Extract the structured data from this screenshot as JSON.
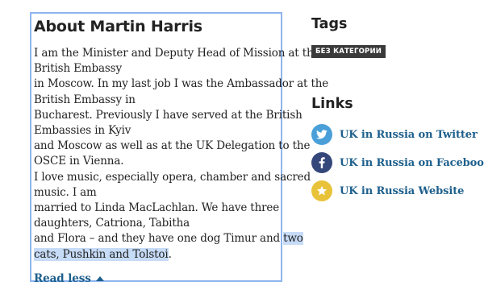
{
  "about": {
    "title": "About Martin Harris",
    "bio_lines": [
      "I am the Minister and Deputy Head of Mission at the",
      "British Embassy",
      "in Moscow. In my last job I was the Ambassador at the",
      "British Embassy in",
      "Bucharest. Previously I have served at the British",
      "Embassies in Kyiv",
      "and Moscow as well as at the UK Delegation to the",
      "OSCE in Vienna.",
      "I love music, especially opera, chamber and sacred",
      "music. I am",
      "married to Linda MacLachlan. We have three",
      "daughters, Catriona, Tabitha"
    ],
    "line13_plain": "and Flora – and they have one dog Timur and ",
    "line13_selected": "two",
    "line14_selected": "cats, Pushkin and Tolstoi",
    "line14_tail": ".",
    "read_less": "Read less"
  },
  "sidebar": {
    "tags_title": "Tags",
    "tag": "БЕЗ КАТЕГОРИИ",
    "links_title": "Links",
    "links": [
      {
        "label": "UK in Russia on Twitter",
        "icon": "twitter-icon",
        "color": "#4a9fd8"
      },
      {
        "label": "UK in Russia on Facebook",
        "icon": "facebook-icon",
        "color": "#34477a"
      },
      {
        "label": "UK in Russia Website",
        "icon": "star-icon",
        "color": "#e8c33a"
      }
    ]
  }
}
